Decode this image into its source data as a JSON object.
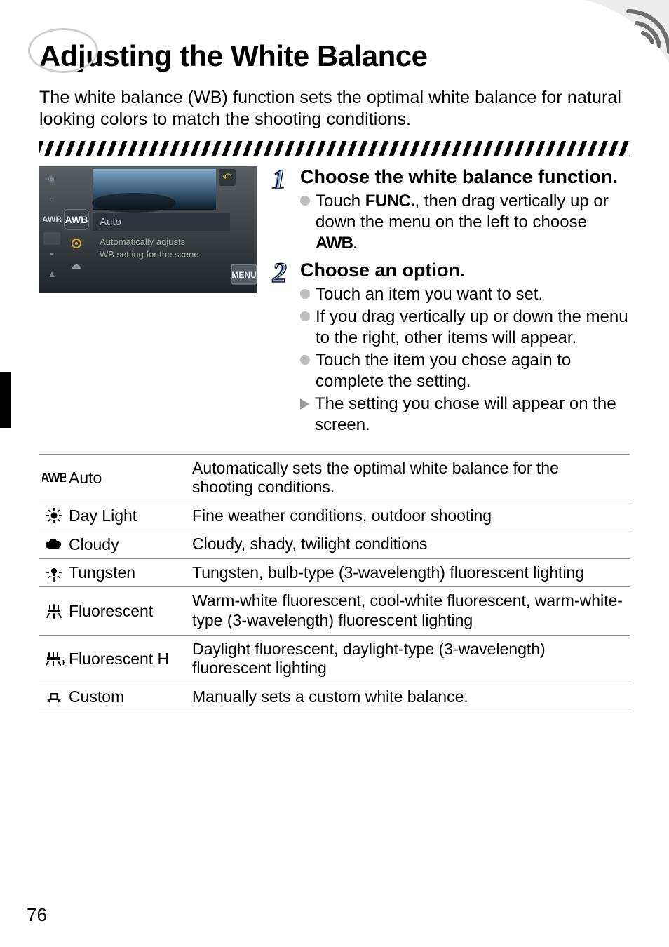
{
  "title": "Adjusting the White Balance",
  "intro": "The white balance (WB) function sets the optimal white balance for natural looking colors to match the shooting conditions.",
  "page_number": "76",
  "screenshot": {
    "selected_label": "AWB",
    "mode_name": "Auto",
    "desc_line1": "Automatically adjusts",
    "desc_line2": "WB setting for the scene",
    "menu_label": "MENU"
  },
  "steps": [
    {
      "heading": "Choose the white balance function.",
      "bullets": [
        {
          "type": "circle",
          "pre": "Touch ",
          "glyph": "FUNC.",
          "mid": ", then drag vertically up or down the menu on the left to choose ",
          "glyph2": "AWB",
          "post": "."
        }
      ]
    },
    {
      "heading": "Choose an option.",
      "bullets": [
        {
          "type": "circle",
          "text": "Touch an item you want to set."
        },
        {
          "type": "circle",
          "text": "If you drag vertically up or down the menu to the right, other items will appear."
        },
        {
          "type": "circle",
          "text": "Touch the item you chose again to complete the setting."
        },
        {
          "type": "tri",
          "text": "The setting you chose will appear on the screen."
        }
      ]
    }
  ],
  "table": [
    {
      "icon": "awb",
      "name": "Auto",
      "name_suffix": "",
      "desc": "Automatically sets the optimal white balance for the shooting conditions."
    },
    {
      "icon": "sun",
      "name": "Day Light",
      "desc": "Fine weather conditions, outdoor shooting"
    },
    {
      "icon": "cloud",
      "name": "Cloudy",
      "desc": "Cloudy, shady, twilight conditions"
    },
    {
      "icon": "tungsten",
      "name": "Tungsten",
      "desc": "Tungsten, bulb-type (3-wavelength) fluorescent lighting"
    },
    {
      "icon": "fluor",
      "name": "Fluorescent",
      "desc": "Warm-white fluorescent, cool-white fluorescent, warm-white-type (3-wavelength) fluorescent lighting"
    },
    {
      "icon": "fluorh",
      "name": "Fluorescent H",
      "desc": "Daylight fluorescent, daylight-type (3-wavelength) fluorescent lighting"
    },
    {
      "icon": "custom",
      "name": "Custom",
      "desc": "Manually sets a custom white balance."
    }
  ]
}
